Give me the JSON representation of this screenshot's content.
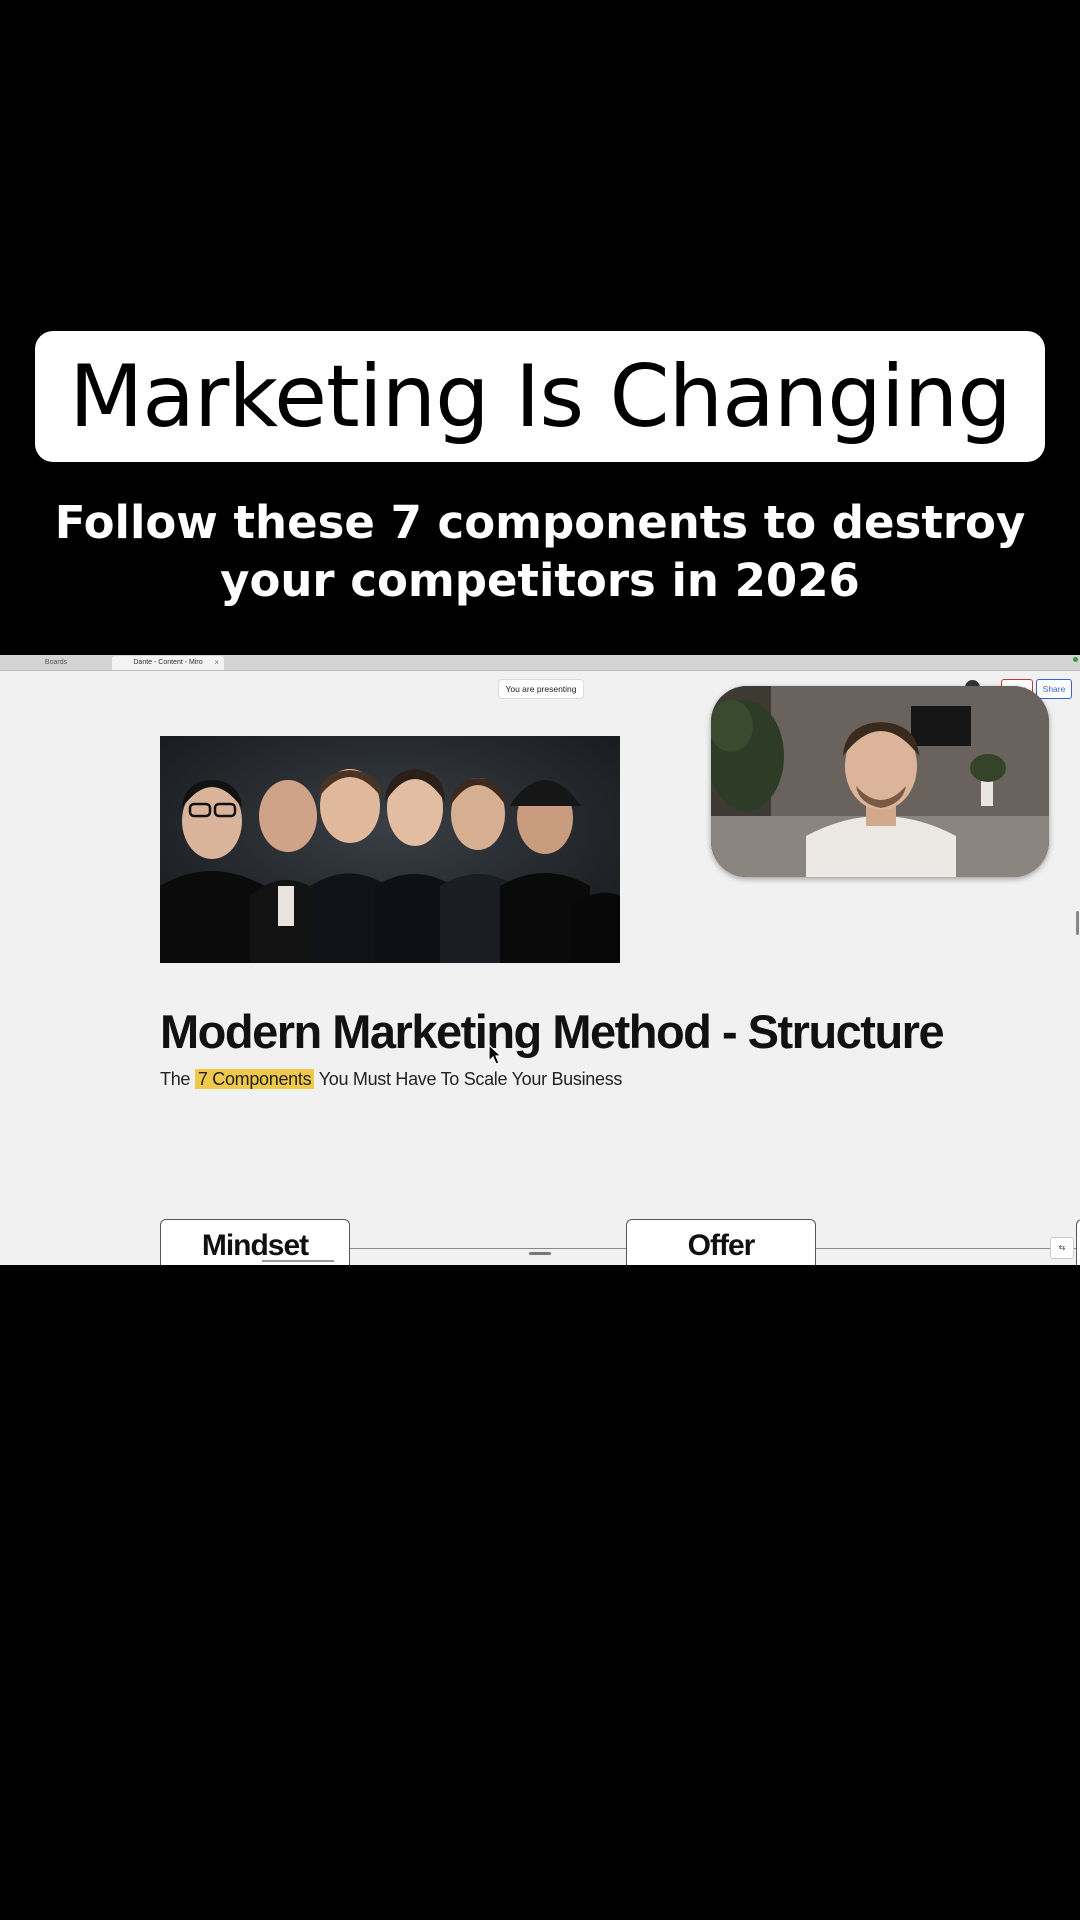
{
  "overlay": {
    "title": "Marketing Is Changing",
    "subtitle_line1": "Follow these 7 components to destroy",
    "subtitle_line2": "your competitors in 2026"
  },
  "browser": {
    "tabs": [
      {
        "label": "Boards"
      },
      {
        "label": "Dante - Content - Miro",
        "close": "×"
      }
    ]
  },
  "toolbar": {
    "presenting_label": "You are presenting",
    "stop_label": "Stop",
    "share_label": "Share"
  },
  "board": {
    "heading": "Modern Marketing Method - Structure",
    "sub_prefix": "The",
    "sub_highlight": "7 Components",
    "sub_suffix": "You Must Have To Scale Your Business",
    "cards": [
      {
        "label": "Mindset"
      },
      {
        "label": "Offer"
      }
    ]
  },
  "colors": {
    "highlight": "#f0c94a",
    "stop": "#cc3333",
    "share": "#3b5fd8"
  }
}
